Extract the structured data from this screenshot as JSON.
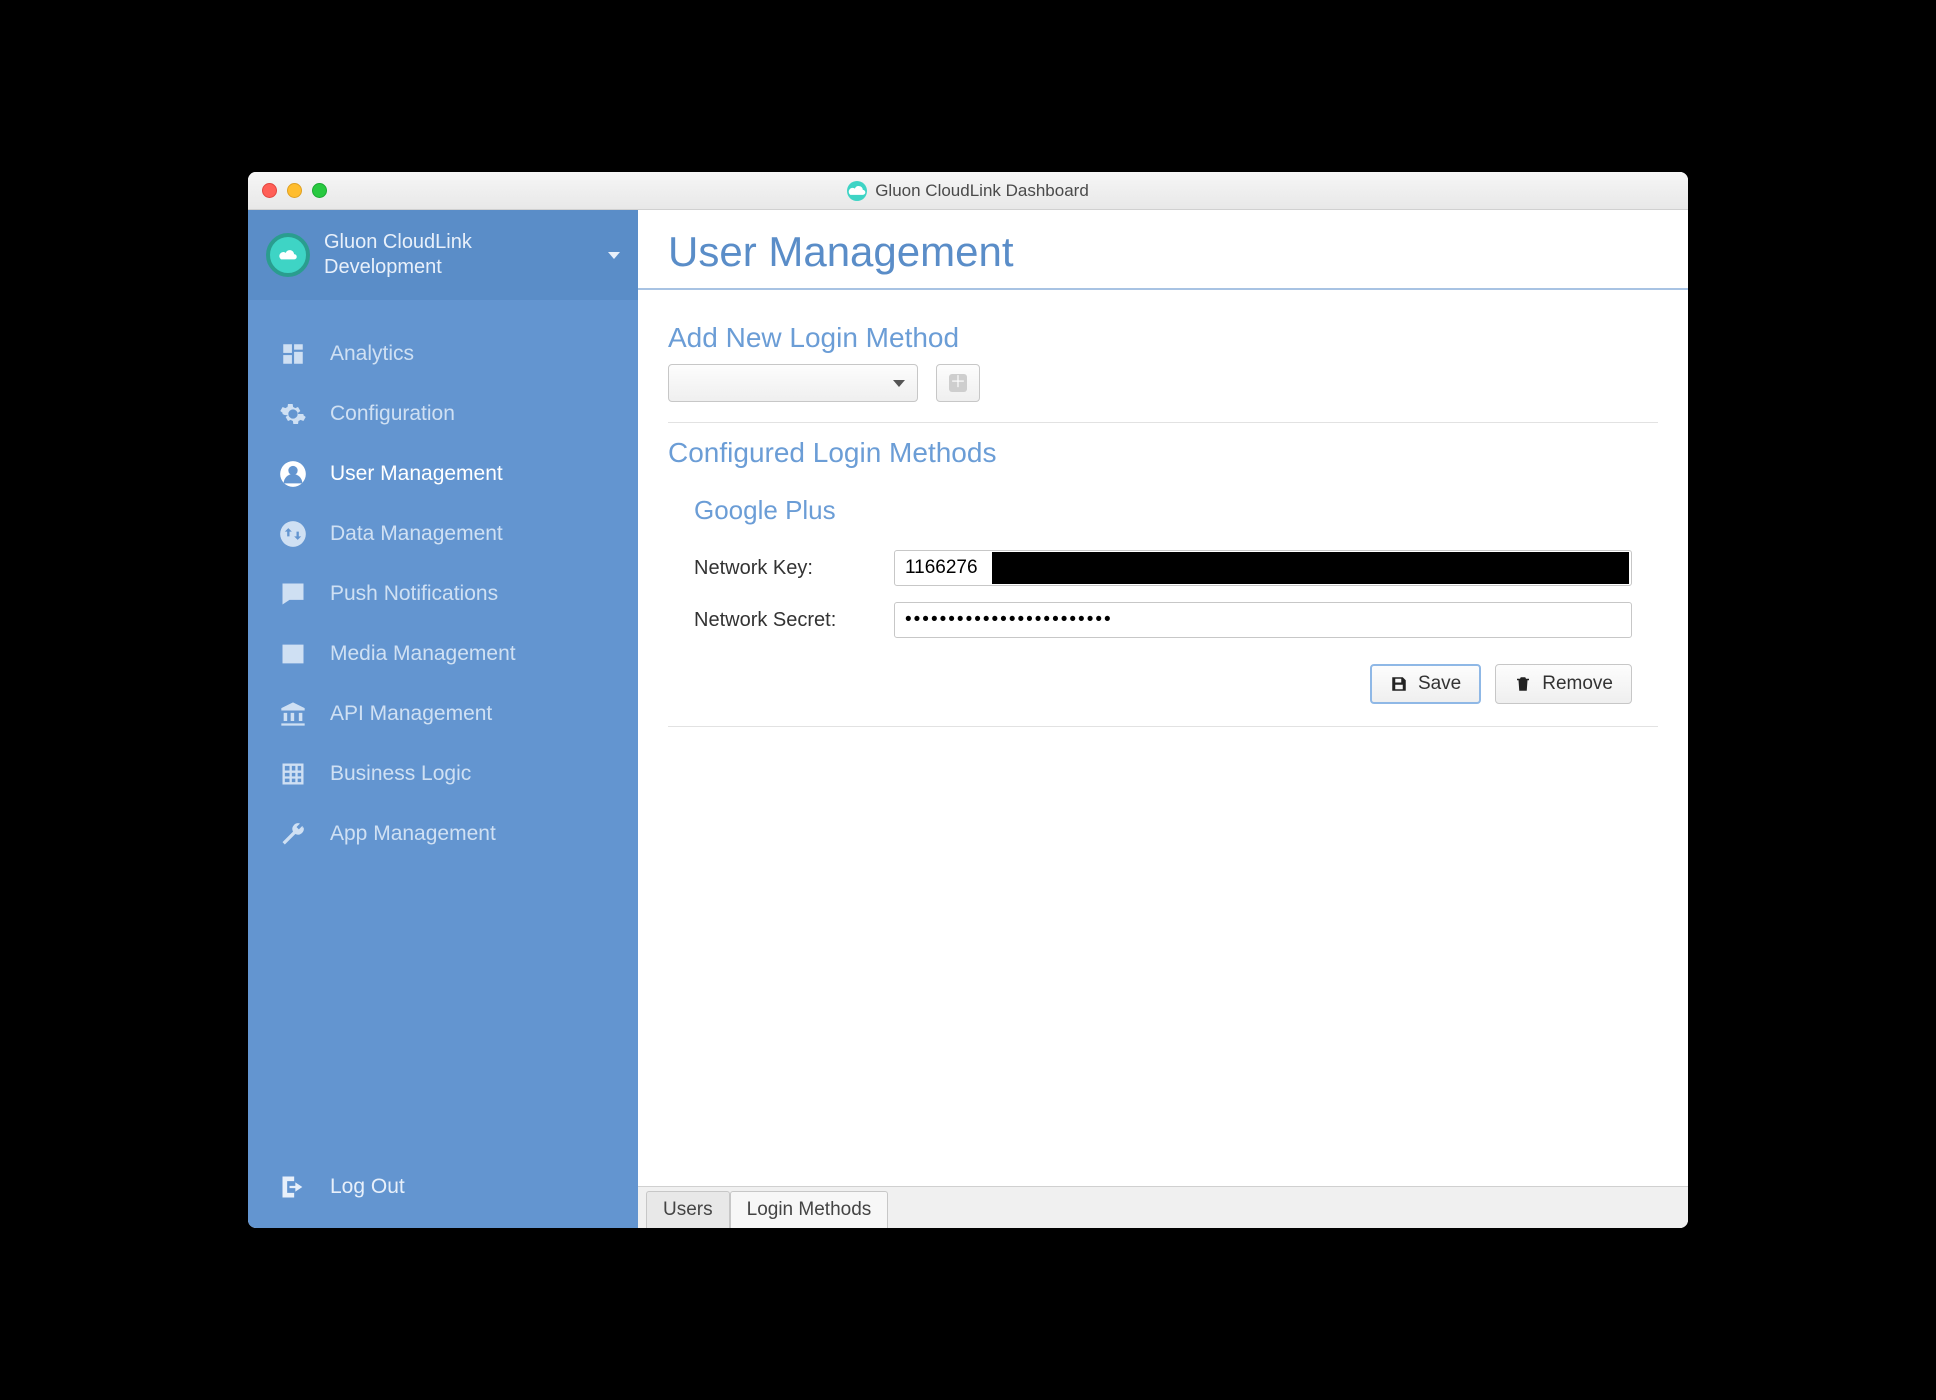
{
  "window": {
    "title": "Gluon CloudLink Dashboard"
  },
  "brand": {
    "line1": "Gluon CloudLink",
    "line2": "Development"
  },
  "sidebar": {
    "items": [
      {
        "label": "Analytics",
        "icon": "dashboard-icon"
      },
      {
        "label": "Configuration",
        "icon": "gear-icon"
      },
      {
        "label": "User Management",
        "icon": "user-icon"
      },
      {
        "label": "Data Management",
        "icon": "swap-icon"
      },
      {
        "label": "Push Notifications",
        "icon": "chat-icon"
      },
      {
        "label": "Media Management",
        "icon": "image-icon"
      },
      {
        "label": "API Management",
        "icon": "bank-icon"
      },
      {
        "label": "Business Logic",
        "icon": "grid-icon"
      },
      {
        "label": "App Management",
        "icon": "wrench-icon"
      }
    ],
    "activeIndex": 2,
    "logout_label": "Log Out"
  },
  "page": {
    "title": "User Management",
    "add_section_title": "Add New Login Method",
    "configured_section_title": "Configured Login Methods",
    "dropdown_value": "",
    "add_button_label": "+"
  },
  "method": {
    "name": "Google Plus",
    "key_label": "Network Key:",
    "key_value": "1166276",
    "secret_label": "Network Secret:",
    "secret_value": "••••••••••••••••••••••••",
    "save_label": "Save",
    "remove_label": "Remove"
  },
  "tabs": {
    "users": "Users",
    "login_methods": "Login Methods",
    "activeIndex": 1
  }
}
